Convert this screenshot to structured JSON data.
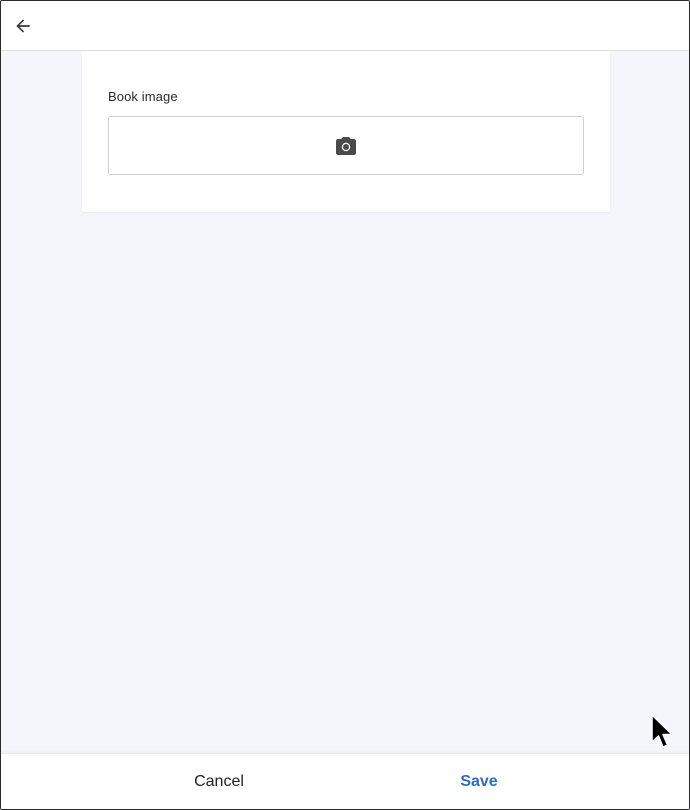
{
  "header": {
    "back_icon": "arrow-left-icon"
  },
  "form": {
    "image_label": "Book image",
    "image_icon": "camera-icon"
  },
  "footer": {
    "cancel_label": "Cancel",
    "save_label": "Save"
  },
  "colors": {
    "background": "#f5f5fc",
    "accent": "#2f6db5",
    "icon": "#4a4a4a"
  }
}
